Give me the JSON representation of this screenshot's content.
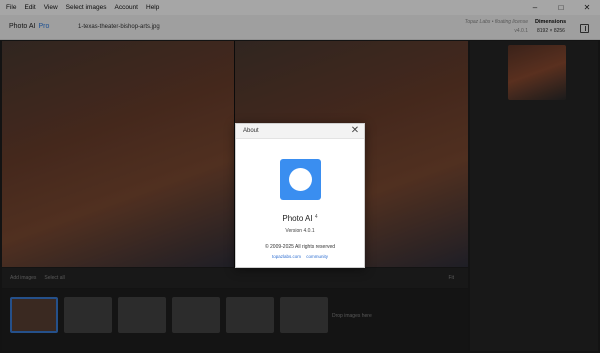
{
  "menubar": {
    "items": [
      "File",
      "Edit",
      "View",
      "Select images",
      "Account",
      "Help"
    ]
  },
  "window_controls": {
    "minimize": "–",
    "maximize": "□",
    "close": "✕"
  },
  "titlebar": {
    "app_name": "Photo AI",
    "badge": "Pro",
    "filename": "1-texas-theater-bishop-arts.jpg",
    "license": "Topaz Labs • floating license",
    "version": "v4.0.1",
    "dimensions_label": "Dimensions",
    "dimensions_value": "8192 × 8256"
  },
  "canvas_toolbar": {
    "add_images": "Add images",
    "select_all": "Select all",
    "fit": "Fit"
  },
  "filmstrip": {
    "drop_label": "Drop images here"
  },
  "about_dialog": {
    "title": "About",
    "close_icon": "✕",
    "app_name": "Photo AI",
    "app_major": "4",
    "version": "Version 4.0.1",
    "copyright": "© 2009-2025 All rights reserved",
    "link_1": "topazlabs.com",
    "link_2": "community"
  },
  "colors": {
    "accent": "#2f7de1",
    "app_icon": "#3a8ef0"
  }
}
